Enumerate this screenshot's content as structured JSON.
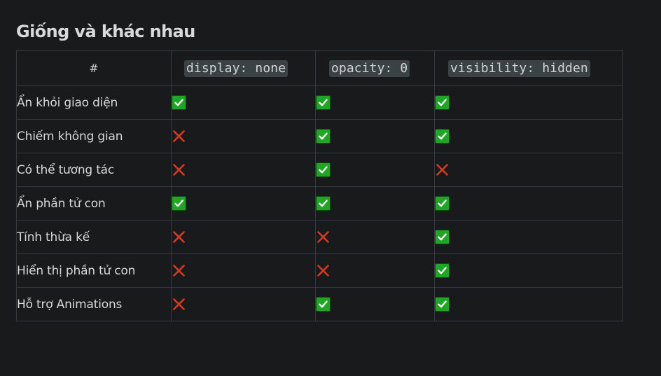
{
  "title": "Giống và khác nhau",
  "table": {
    "headers": [
      "#",
      "display: none",
      "opacity: 0",
      "visibility: hidden"
    ],
    "rows": [
      {
        "label": "Ẩn khỏi giao diện",
        "values": [
          "yes",
          "yes",
          "yes"
        ]
      },
      {
        "label": "Chiếm không gian",
        "values": [
          "no",
          "yes",
          "yes"
        ]
      },
      {
        "label": "Có thể tương tác",
        "values": [
          "no",
          "yes",
          "no"
        ]
      },
      {
        "label": "Ẩn phần tử con",
        "values": [
          "yes",
          "yes",
          "yes"
        ]
      },
      {
        "label": "Tính thừa kế",
        "values": [
          "no",
          "no",
          "yes"
        ]
      },
      {
        "label": "Hiển thị phần tử con",
        "values": [
          "no",
          "no",
          "yes"
        ]
      },
      {
        "label": "Hỗ trợ Animations",
        "values": [
          "no",
          "yes",
          "yes"
        ]
      }
    ]
  },
  "icons": {
    "yes": "check-mark-button-icon",
    "no": "cross-mark-icon"
  },
  "colors": {
    "background": "#181a1b",
    "check_green": "#1fa624",
    "cross_red": "#d33a20",
    "code_bg": "#3a4246"
  }
}
